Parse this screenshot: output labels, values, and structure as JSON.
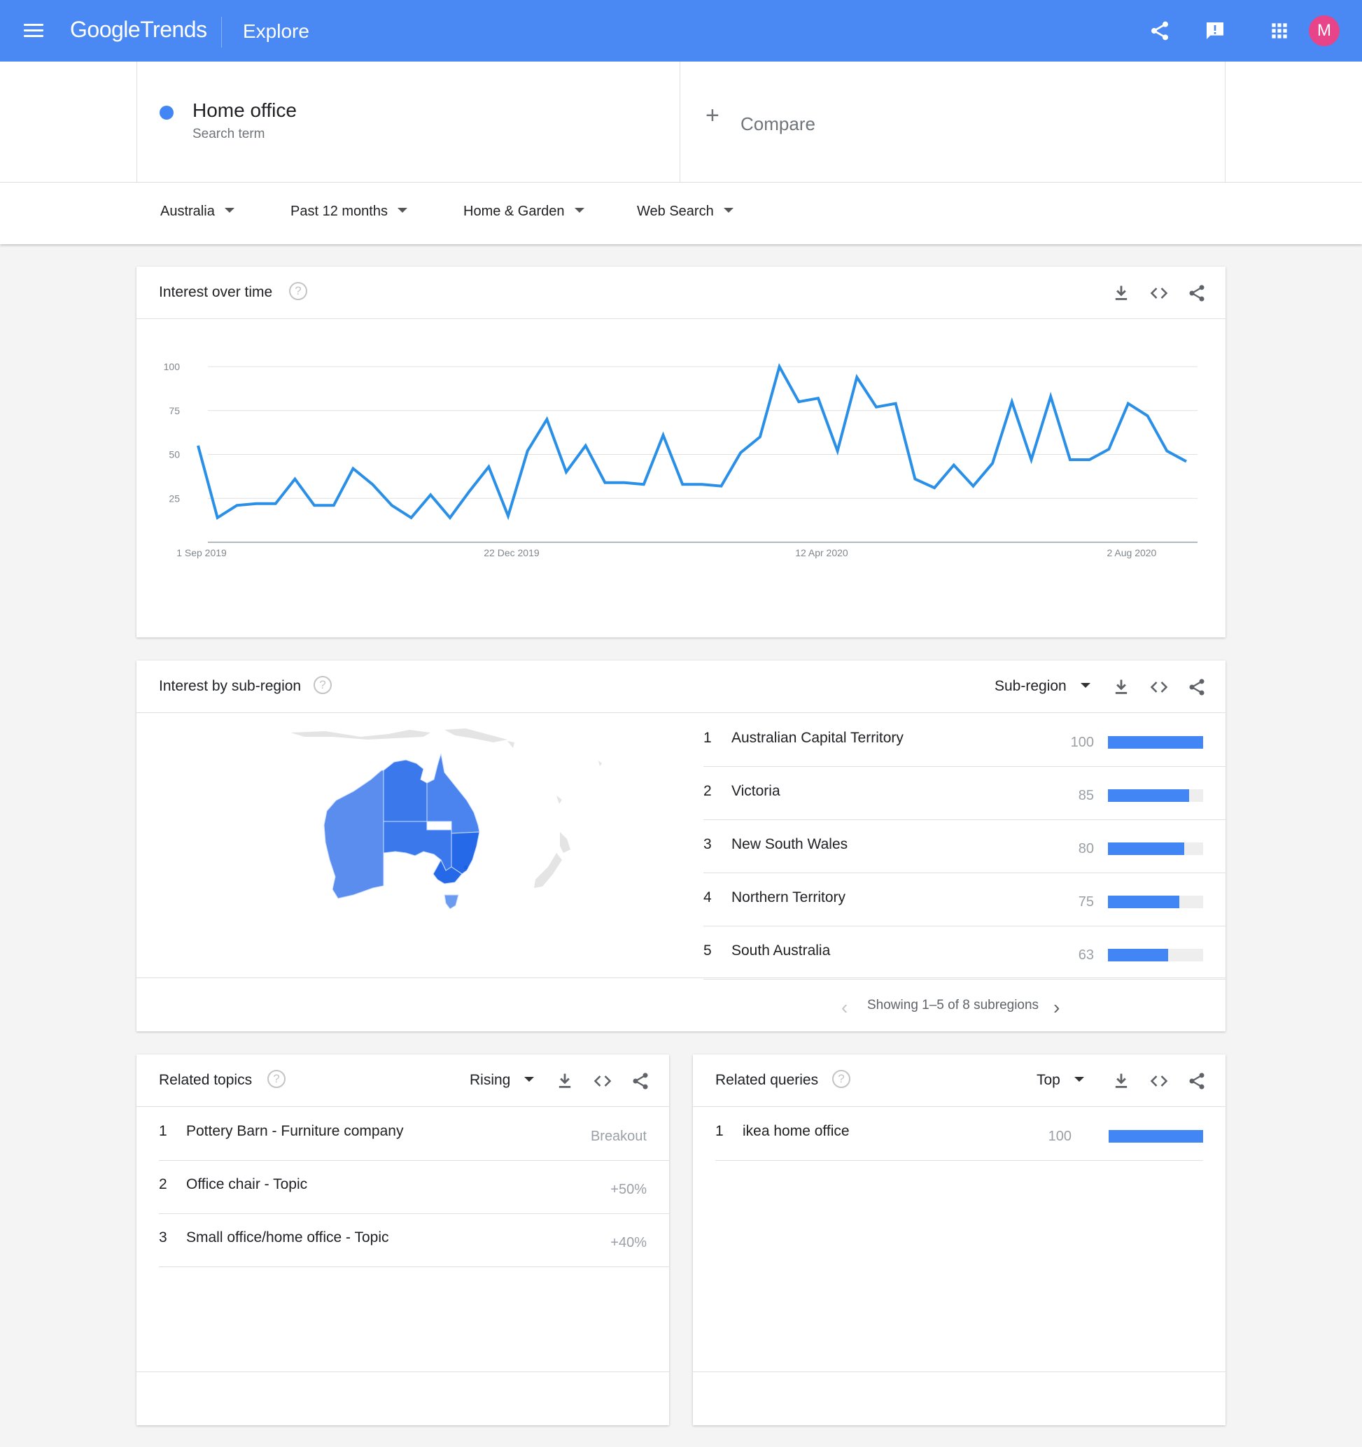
{
  "header": {
    "logo_google": "Google",
    "logo_trends": "Trends",
    "section": "Explore",
    "avatar_letter": "M",
    "icons": [
      "menu-icon",
      "share-icon",
      "feedback-icon",
      "apps-icon"
    ]
  },
  "search": {
    "term": "Home office",
    "term_type": "Search term",
    "compare_plus": "+",
    "compare_label": "Compare",
    "term_color": "#4285f4"
  },
  "filters": {
    "region": "Australia",
    "time": "Past 12 months",
    "category": "Home & Garden",
    "property": "Web Search"
  },
  "interest_over_time": {
    "title": "Interest over time",
    "help": "?"
  },
  "chart_data": {
    "type": "line",
    "title": "",
    "xlabel": "",
    "ylabel": "",
    "ylim": [
      0,
      100
    ],
    "y_ticks": [
      100,
      75,
      50,
      25
    ],
    "x_ticks": [
      "1 Sep 2019",
      "22 Dec 2019",
      "12 Apr 2020",
      "2 Aug 2020"
    ],
    "x_tick_index": [
      0,
      16,
      32,
      48
    ],
    "grid": true,
    "series": [
      {
        "color": "#2a8fe6",
        "values": [
          55,
          14,
          21,
          22,
          22,
          36,
          21,
          21,
          42,
          33,
          21,
          14,
          27,
          14,
          29,
          43,
          15,
          52,
          70,
          40,
          55,
          34,
          34,
          33,
          61,
          33,
          33,
          32,
          51,
          60,
          100,
          80,
          82,
          52,
          94,
          77,
          79,
          36,
          31,
          44,
          32,
          45,
          80,
          47,
          83,
          47,
          47,
          53,
          79,
          72,
          52,
          46
        ]
      }
    ]
  },
  "sub_region": {
    "title": "Interest by sub-region",
    "help": "?",
    "dropdown": "Sub-region",
    "rows": [
      {
        "rank": "1",
        "name": "Australian Capital Territory",
        "value": "100",
        "fraction": 1.0
      },
      {
        "rank": "2",
        "name": "Victoria",
        "value": "85",
        "fraction": 0.85
      },
      {
        "rank": "3",
        "name": "New South Wales",
        "value": "80",
        "fraction": 0.8
      },
      {
        "rank": "4",
        "name": "Northern Territory",
        "value": "75",
        "fraction": 0.75
      },
      {
        "rank": "5",
        "name": "South Australia",
        "value": "63",
        "fraction": 0.63
      }
    ],
    "pager": "Showing 1–5 of 8 subregions",
    "bar_color": "#4285f4"
  },
  "related_topics": {
    "title": "Related topics",
    "help": "?",
    "dropdown": "Rising",
    "rows": [
      {
        "rank": "1",
        "name": "Pottery Barn - Furniture company",
        "value": "Breakout"
      },
      {
        "rank": "2",
        "name": "Office chair - Topic",
        "value": "+50%"
      },
      {
        "rank": "3",
        "name": "Small office/home office - Topic",
        "value": "+40%"
      }
    ]
  },
  "related_queries": {
    "title": "Related queries",
    "help": "?",
    "dropdown": "Top",
    "rows": [
      {
        "rank": "1",
        "name": "ikea home office",
        "value": "100",
        "fraction": 1.0
      }
    ]
  }
}
